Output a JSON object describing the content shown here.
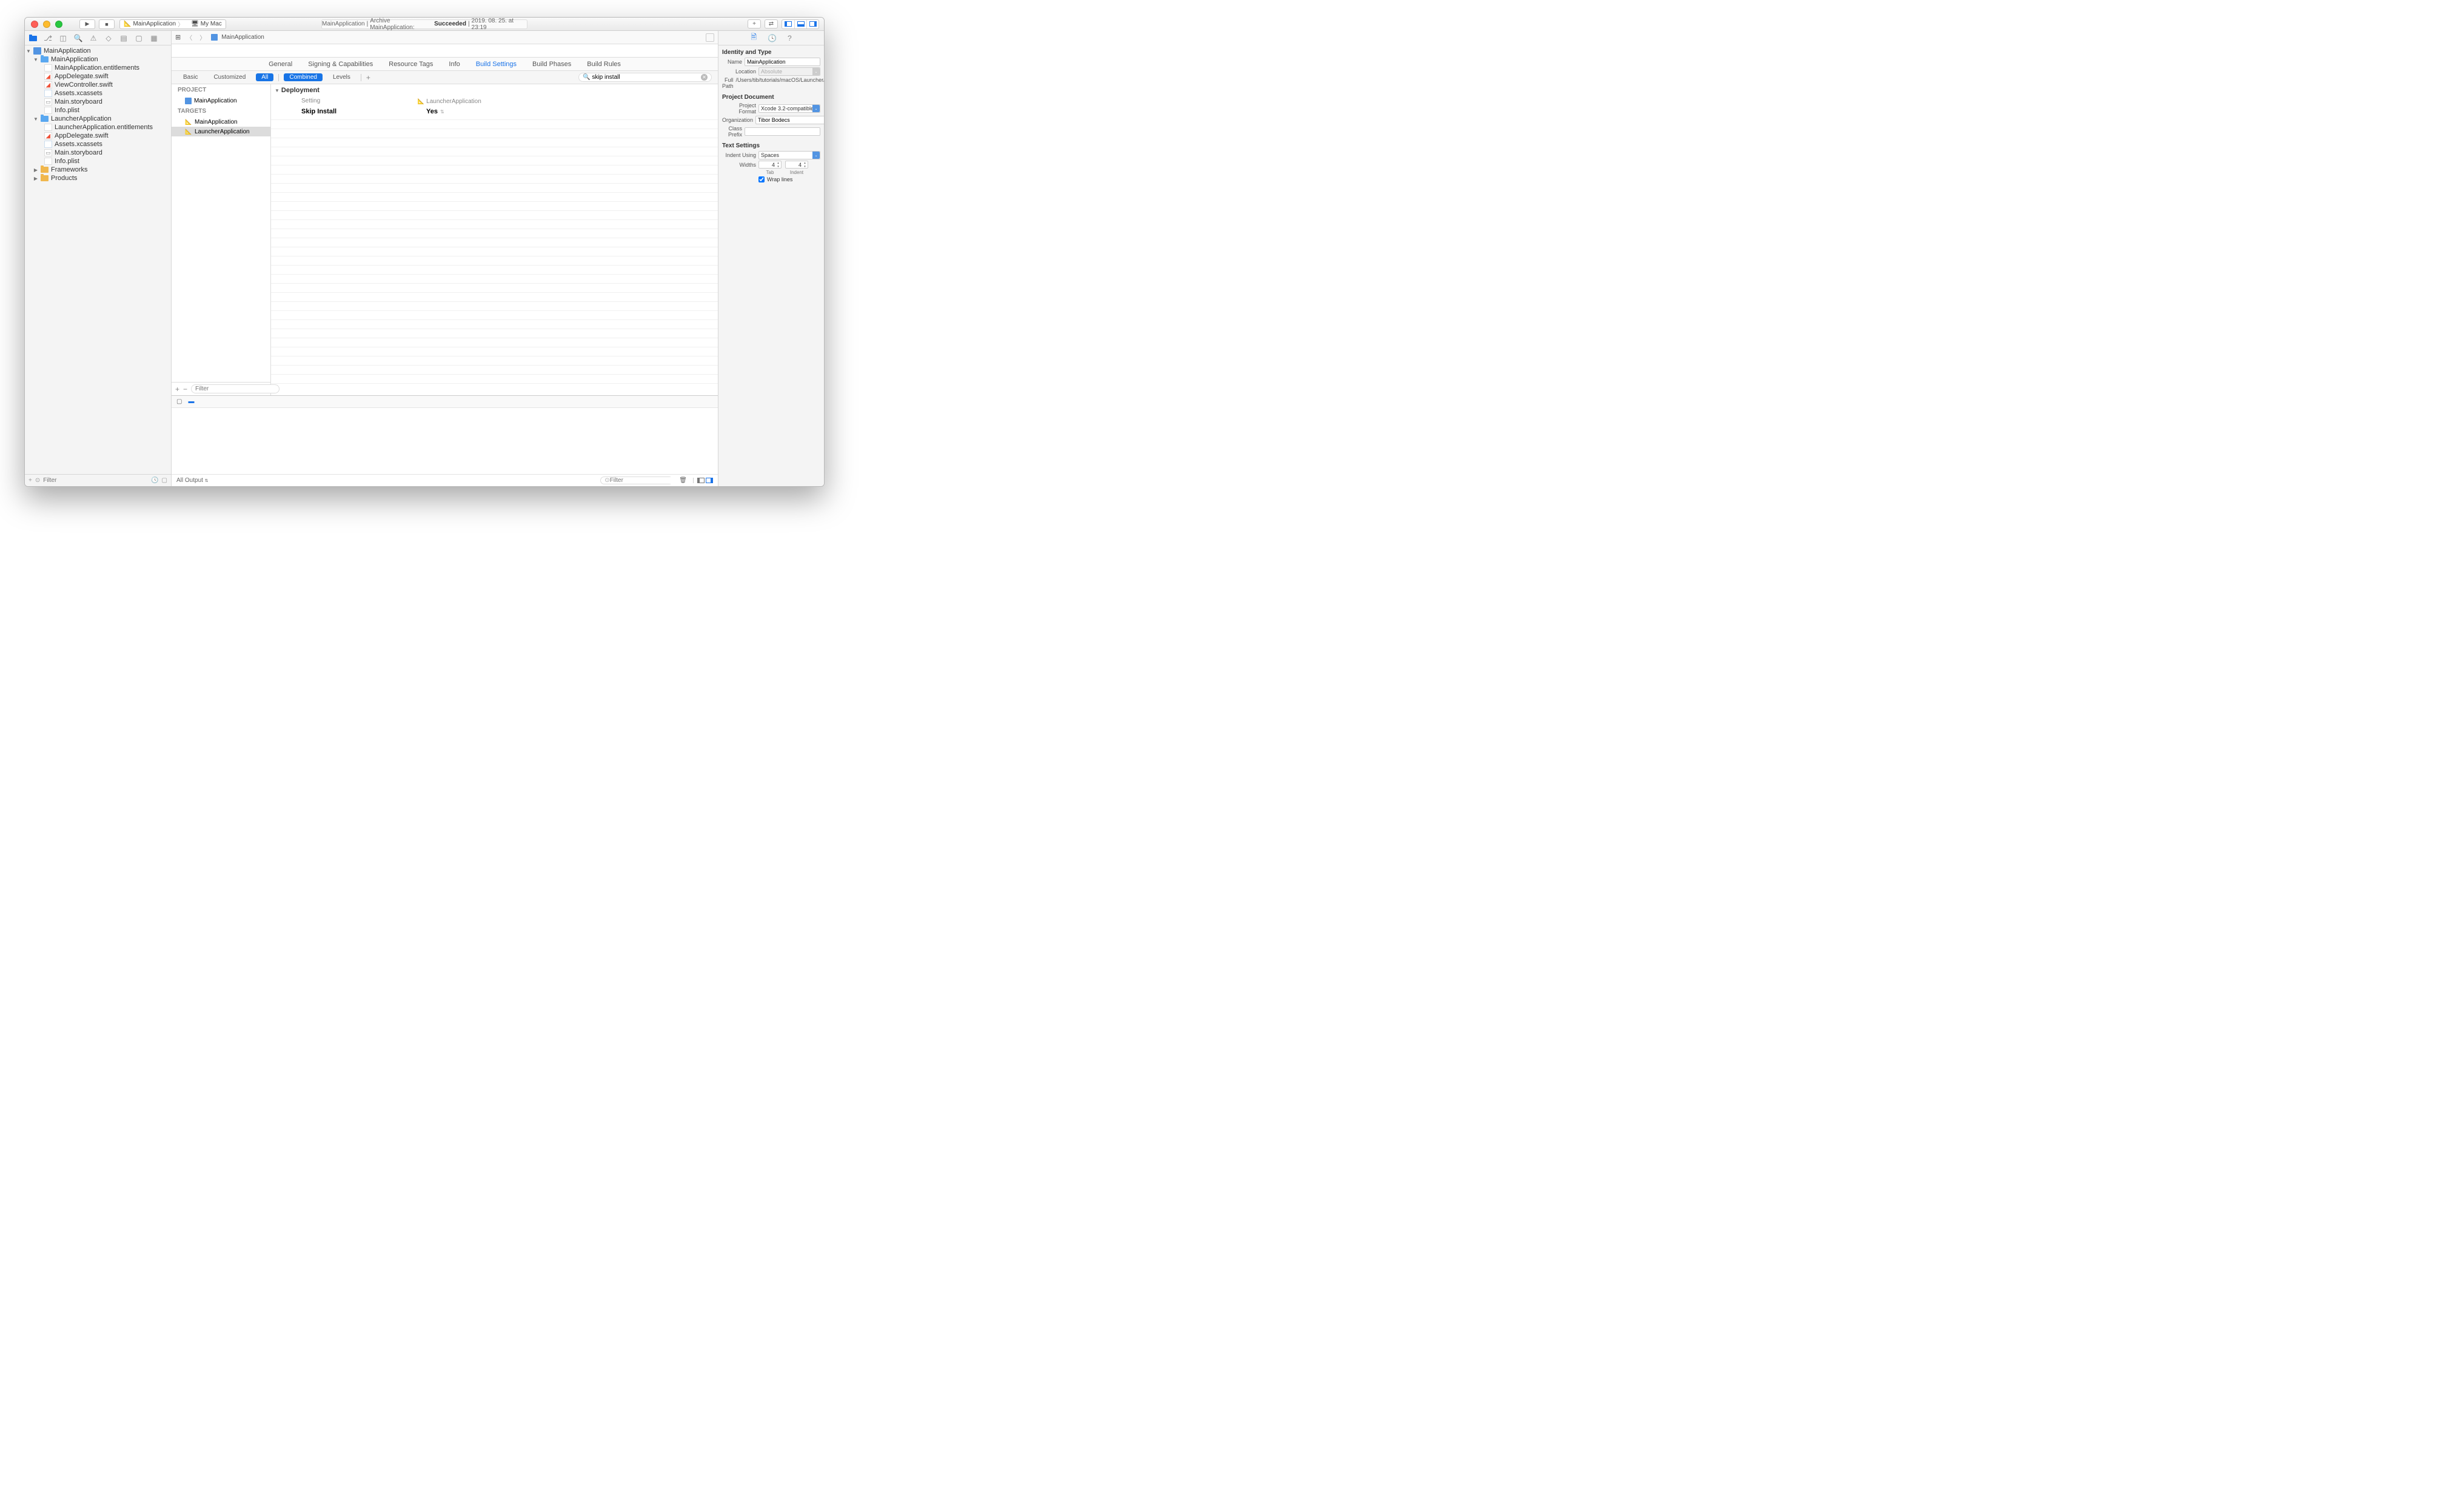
{
  "titlebar": {
    "scheme_target": "MainApplication",
    "scheme_device": "My Mac",
    "activity_project": "MainApplication",
    "activity_action": "Archive MainApplication:",
    "activity_status": "Succeeded",
    "activity_time": "2019. 08. 25. at 23:19"
  },
  "navigator": {
    "project": "MainApplication",
    "group1": "MainApplication",
    "g1_items": [
      "MainApplication.entitlements",
      "AppDelegate.swift",
      "ViewController.swift",
      "Assets.xcassets",
      "Main.storyboard",
      "Info.plist"
    ],
    "group2": "LauncherApplication",
    "g2_items": [
      "LauncherApplication.entitlements",
      "AppDelegate.swift",
      "Assets.xcassets",
      "Main.storyboard",
      "Info.plist"
    ],
    "frameworks": "Frameworks",
    "products": "Products",
    "filter_placeholder": "Filter"
  },
  "jumpbar": {
    "item": "MainApplication"
  },
  "tabs": [
    "General",
    "Signing & Capabilities",
    "Resource Tags",
    "Info",
    "Build Settings",
    "Build Phases",
    "Build Rules"
  ],
  "filterbar": {
    "basic": "Basic",
    "customized": "Customized",
    "all": "All",
    "combined": "Combined",
    "levels": "Levels",
    "search_value": "skip install"
  },
  "targets_pane": {
    "project_hdr": "PROJECT",
    "project": "MainApplication",
    "targets_hdr": "TARGETS",
    "t1": "MainApplication",
    "t2": "LauncherApplication",
    "filter_placeholder": "Filter"
  },
  "settings": {
    "section": "Deployment",
    "col_setting": "Setting",
    "col_target": "LauncherApplication",
    "row_name": "Skip Install",
    "row_value": "Yes"
  },
  "debug": {
    "output": "All Output",
    "filter_placeholder": "Filter"
  },
  "inspector": {
    "identity_hdr": "Identity and Type",
    "name_label": "Name",
    "name_value": "MainApplication",
    "location_label": "Location",
    "location_value": "Absolute",
    "fullpath_label": "Full Path",
    "fullpath_value": "/Users/tib/tutorials/macOS/Launcher/MainApplication.xcodeproj",
    "projdoc_hdr": "Project Document",
    "format_label": "Project Format",
    "format_value": "Xcode 3.2-compatible",
    "org_label": "Organization",
    "org_value": "Tibor Bodecs",
    "prefix_label": "Class Prefix",
    "prefix_value": "",
    "text_hdr": "Text Settings",
    "indent_label": "Indent Using",
    "indent_value": "Spaces",
    "widths_label": "Widths",
    "tab_val": "4",
    "indent_val": "4",
    "tab_lbl": "Tab",
    "indent_lbl": "Indent",
    "wrap": "Wrap lines"
  }
}
